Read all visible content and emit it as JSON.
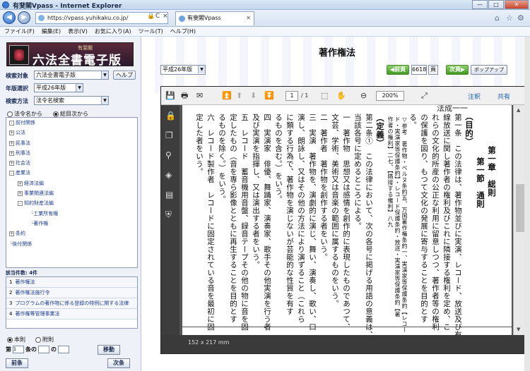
{
  "window": {
    "title": "有斐閣Vpass - Internet Explorer",
    "min": "—",
    "max": "□",
    "close": "✕"
  },
  "browser": {
    "url": "https://vpass.yuhikaku.co.jp/",
    "tab_label": "有斐閣Vpass",
    "tab_close": "✕",
    "back": "◀",
    "forward": "▶",
    "addr_icons": [
      "🔒",
      "C",
      "×"
    ],
    "right_icons": [
      "⌂",
      "☆",
      "⚙"
    ]
  },
  "menu": [
    "ファイル(F)",
    "編集(E)",
    "表示(V)",
    "お気に入り(A)",
    "ツール(T)",
    "ヘルプ(H)"
  ],
  "left": {
    "logo_small": "有斐閣",
    "logo_big": "六法全書電子版",
    "target_label": "検索対象",
    "target_value": "六法全書電子版",
    "help_label": "ヘルプ",
    "edition_label": "年版選択",
    "edition_value": "平成26年版",
    "method_label": "検索方法",
    "method_value": "法令名検索",
    "radio_law": "法令名から",
    "radio_toc": "総目次から",
    "tree": [
      {
        "mark": "-",
        "label": "前付関係"
      },
      {
        "mark": "+",
        "label": "公法"
      },
      {
        "mark": "+",
        "label": "民事法"
      },
      {
        "mark": "+",
        "label": "刑事法"
      },
      {
        "mark": "+",
        "label": "社会法"
      },
      {
        "mark": "-",
        "label": "産業法"
      },
      {
        "mark": "+",
        "label": "経済法編"
      },
      {
        "mark": "+",
        "label": "事業関連法編"
      },
      {
        "mark": "-",
        "label": "知的財産法編"
      },
      {
        "mark": "",
        "label": "工業所有権"
      },
      {
        "mark": "",
        "label": "著作権"
      },
      {
        "mark": "+",
        "label": "条約"
      },
      {
        "mark": "",
        "label": "後付関係"
      }
    ],
    "count_label": "該当件数: 4件",
    "results": [
      {
        "num": "1",
        "text": "著作権法"
      },
      {
        "num": "2",
        "text": "著作権法施行令"
      },
      {
        "num": "3",
        "text": "プログラムの著作物に係る登録の特例に関する法律"
      },
      {
        "num": "4",
        "text": "著作権等管理事業法"
      }
    ],
    "radio_main": "本則",
    "radio_supp": "附則",
    "art_prefix": "第",
    "art_1": "1",
    "art_mid": "条の",
    "art_no": "の",
    "move_label": "移動",
    "prev_label": "前条",
    "next_label": "次条"
  },
  "main": {
    "title": "著作権法",
    "edition": "平成26年版",
    "prev_page": "◀前頁",
    "page_value": "6618",
    "page_unit": "頁",
    "next_page": "次頁▶",
    "popup": "ポップアップ",
    "pdf": {
      "page_current": "1",
      "page_total": "/ 1",
      "zoom": "200%",
      "annotate": "注釈",
      "share": "共有",
      "size": "152 x 217 mm",
      "running_head": "法成一一"
    }
  },
  "text_columns": [
    {
      "t": "第一章　総則",
      "cls": "h"
    },
    {
      "t": "第一節　通則",
      "cls": "h"
    },
    {
      "t": "（目的）",
      "cls": "h"
    },
    {
      "t": "第一条　この法律は、著作物並びに実演、レコード、放送及び有",
      "cls": ""
    },
    {
      "t": "線放送に関し著作者の権利及びこれに隣接する権利を定め、こ",
      "cls": ""
    },
    {
      "t": "れらの文化的所産の公正な利用に留意しつつ、著作者等の権利",
      "cls": ""
    },
    {
      "t": "の保護を図り、もつて文化の発展に寄与することを目的とす",
      "cls": ""
    },
    {
      "t": "る。",
      "cls": ""
    },
    {
      "t": "▽参考　著作物・ベルヌ条約五、万国著作権条約一、実演家等保護条約【レコー",
      "cls": "s"
    },
    {
      "t": "ド・実演家等保護条約】・レコード保護条約・放送・実演家等保護条約【著",
      "cls": "s"
    },
    {
      "t": "作者の権利】二七、【隣接する権利】八九",
      "cls": "s"
    },
    {
      "t": "（定義）",
      "cls": "h"
    },
    {
      "t": "第二条①　この法律において、次の各号に掲げる用語の意義は、",
      "cls": ""
    },
    {
      "t": "当該各号に定めるところによる。",
      "cls": ""
    },
    {
      "t": "一　著作物　思想又は感情を創作的に表現したものであつて、",
      "cls": ""
    },
    {
      "t": "文芸、学術、美術又は音楽の範囲に属するものをいう。",
      "cls": ""
    },
    {
      "t": "二　著作者　著作物を創作する者をいう。",
      "cls": ""
    },
    {
      "t": "三　実演　著作物を、演劇的に演じ、舞い、演奏し、歌い、口",
      "cls": ""
    },
    {
      "t": "演し、朗詠し、又はその他の方法により演ずること（これら",
      "cls": ""
    },
    {
      "t": "に類する行為で、著作物を演じないが芸能的な性質を有す",
      "cls": ""
    },
    {
      "t": "るものを含む。）をいう。",
      "cls": ""
    },
    {
      "t": "四　実演家　俳優、舞踊家、演奏家、歌手その他実演を行う者",
      "cls": ""
    },
    {
      "t": "及び実演を指揮し、又は演出する者をいう。",
      "cls": ""
    },
    {
      "t": "五　レコード　蓄音機用音盤、録音テープその他の物に音を固",
      "cls": ""
    },
    {
      "t": "定したもの（音を専ら影像とともに再生することを目的とす",
      "cls": ""
    },
    {
      "t": "るものを除く。）をいう。",
      "cls": ""
    },
    {
      "t": "六　レコード製作者　レコードに固定されている音を最初に固",
      "cls": ""
    },
    {
      "t": "定した者をいう。",
      "cls": ""
    }
  ]
}
